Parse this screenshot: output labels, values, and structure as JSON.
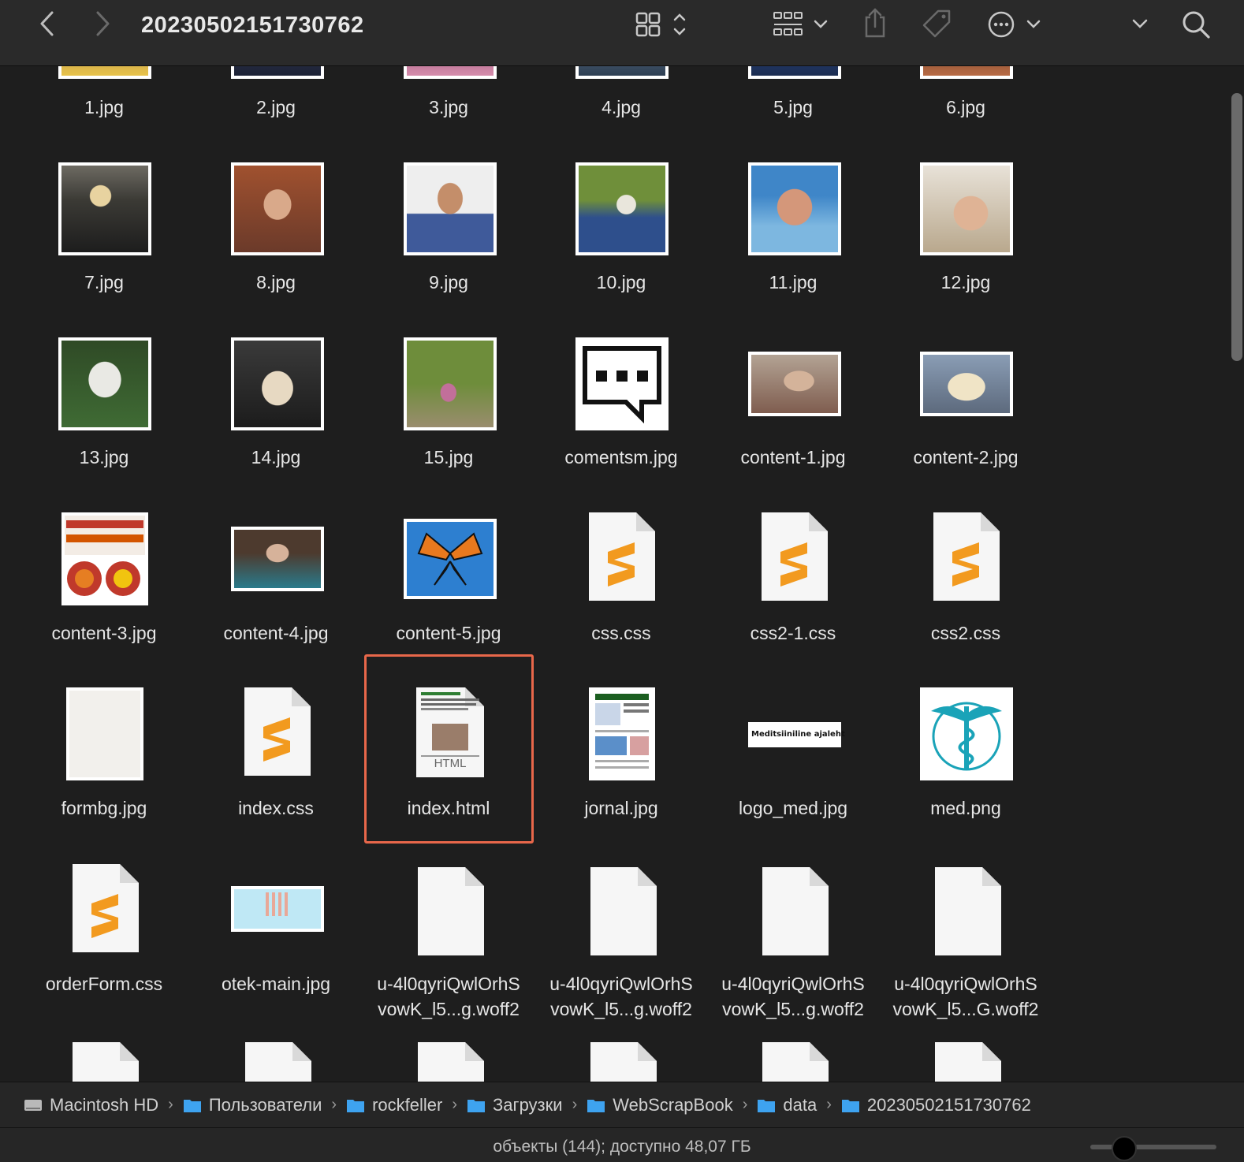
{
  "window": {
    "title": "20230502151730762"
  },
  "toolbar": {
    "back": "back-icon",
    "forward": "forward-icon",
    "view_mode": "grid-view-icon",
    "group": "group-icon",
    "share": "share-icon",
    "tag": "tag-icon",
    "more": "more-icon",
    "expand": "chevron-down-icon",
    "search": "search-icon"
  },
  "files": [
    {
      "name": "1.jpg"
    },
    {
      "name": "2.jpg"
    },
    {
      "name": "3.jpg"
    },
    {
      "name": "4.jpg"
    },
    {
      "name": "5.jpg"
    },
    {
      "name": "6.jpg"
    },
    {
      "name": "7.jpg"
    },
    {
      "name": "8.jpg"
    },
    {
      "name": "9.jpg"
    },
    {
      "name": "10.jpg"
    },
    {
      "name": "11.jpg"
    },
    {
      "name": "12.jpg"
    },
    {
      "name": "13.jpg"
    },
    {
      "name": "14.jpg"
    },
    {
      "name": "15.jpg"
    },
    {
      "name": "comentsm.jpg"
    },
    {
      "name": "content-1.jpg"
    },
    {
      "name": "content-2.jpg"
    },
    {
      "name": "content-3.jpg"
    },
    {
      "name": "content-4.jpg"
    },
    {
      "name": "content-5.jpg"
    },
    {
      "name": "css.css"
    },
    {
      "name": "css2-1.css"
    },
    {
      "name": "css2.css"
    },
    {
      "name": "formbg.jpg"
    },
    {
      "name": "index.css"
    },
    {
      "name": "index.html",
      "selected": true
    },
    {
      "name": "jornal.jpg"
    },
    {
      "name": "logo_med.jpg"
    },
    {
      "name": "med.png"
    },
    {
      "name": "orderForm.css"
    },
    {
      "name": "otek-main.jpg"
    },
    {
      "name": "u-4l0qyriQwlOrhS",
      "name2": "vowK_l5...g.woff2"
    },
    {
      "name": "u-4l0qyriQwlOrhS",
      "name2": "vowK_l5...g.woff2"
    },
    {
      "name": "u-4l0qyriQwlOrhS",
      "name2": "vowK_l5...g.woff2"
    },
    {
      "name": "u-4l0qyriQwlOrhS",
      "name2": "vowK_l5...G.woff2"
    }
  ],
  "thumb_text": {
    "html_badge": "HTML",
    "logo_med_text": "Meditsiiniline ajaleht"
  },
  "pathbar": [
    {
      "label": "Macintosh HD",
      "icon": "disk-icon"
    },
    {
      "label": "Пользователи",
      "icon": "folder-icon"
    },
    {
      "label": "rockfeller",
      "icon": "folder-icon"
    },
    {
      "label": "Загрузки",
      "icon": "folder-icon"
    },
    {
      "label": "WebScrapBook",
      "icon": "folder-icon"
    },
    {
      "label": "data",
      "icon": "folder-icon"
    },
    {
      "label": "20230502151730762",
      "icon": "folder-icon"
    }
  ],
  "status": {
    "text": "объекты (144); доступно 48,07 ГБ"
  },
  "colors": {
    "selection": "#e8674a",
    "folder": "#3ea3f0",
    "sublime": "#f29a1f"
  }
}
